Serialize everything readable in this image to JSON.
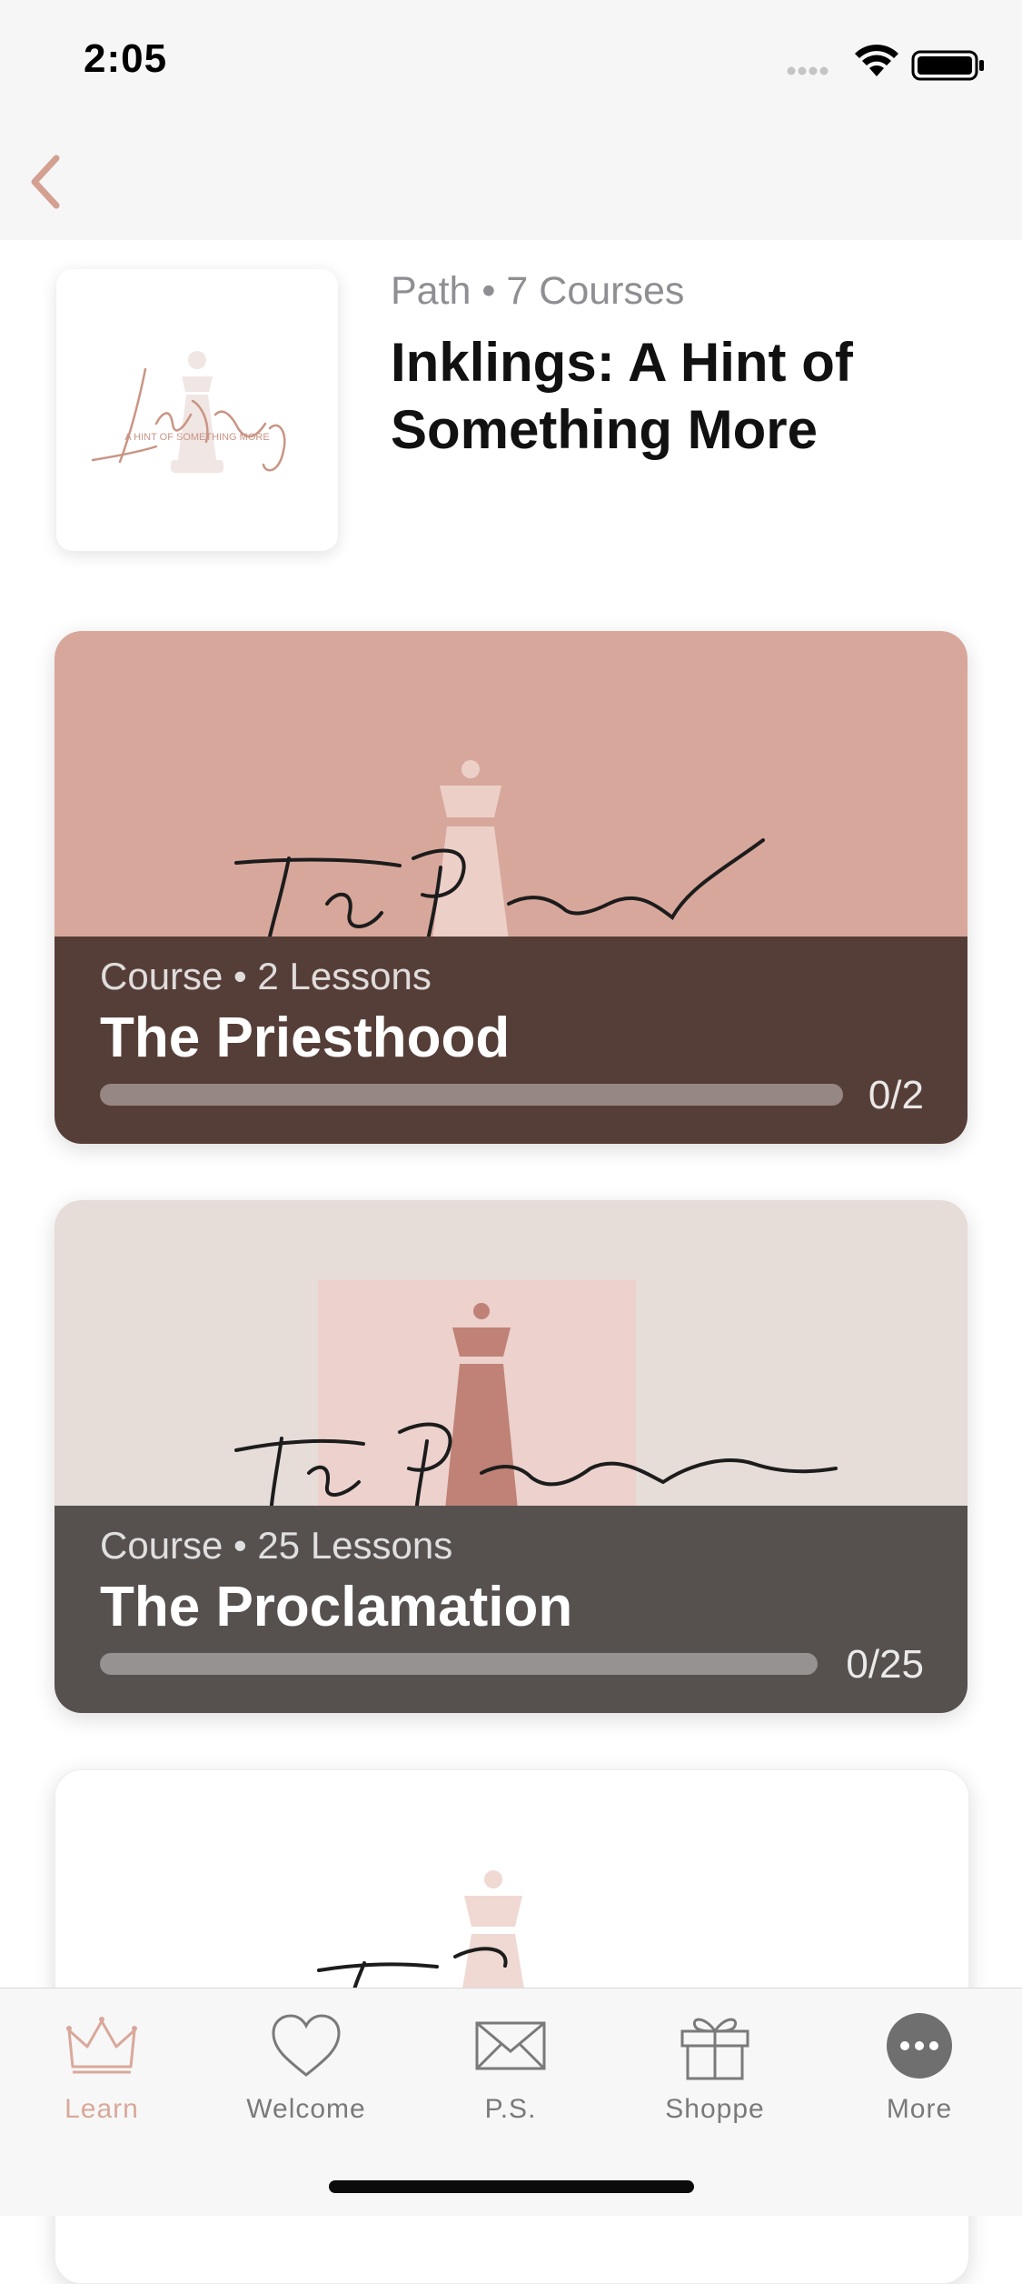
{
  "status_bar": {
    "time": "2:05"
  },
  "nav": {
    "back_icon": "chevron-left-icon"
  },
  "header": {
    "meta": "Path • 7 Courses",
    "title": "Inklings: A Hint of Something More",
    "logo_script": "Inklings",
    "logo_subtitle": "A HINT OF SOMETHING MORE"
  },
  "courses": [
    {
      "meta": "Course • 2 Lessons",
      "title": "The Priesthood",
      "progress_text": "0/2",
      "progress": 0,
      "art_script": "the Priesthood",
      "art_bg": "#d8a79b",
      "panel_bg": "#563e38"
    },
    {
      "meta": "Course • 25 Lessons",
      "title": "The Proclamation",
      "progress_text": "0/25",
      "progress": 0,
      "art_script": "the Proclamation",
      "art_bg": "#e6dcd8",
      "panel_bg": "#56504f"
    },
    {
      "art_script": "the P",
      "art_bg": "#ffffff"
    }
  ],
  "tabbar": {
    "items": [
      {
        "label": "Learn",
        "icon": "crown-icon",
        "active": true
      },
      {
        "label": "Welcome",
        "icon": "heart-icon",
        "active": false
      },
      {
        "label": "P.S.",
        "icon": "envelope-icon",
        "active": false
      },
      {
        "label": "Shoppe",
        "icon": "gift-icon",
        "active": false
      },
      {
        "label": "More",
        "icon": "more-icon",
        "active": false
      }
    ]
  },
  "colors": {
    "accent": "#d9a89b",
    "tab_inactive": "#7a7a7a"
  }
}
